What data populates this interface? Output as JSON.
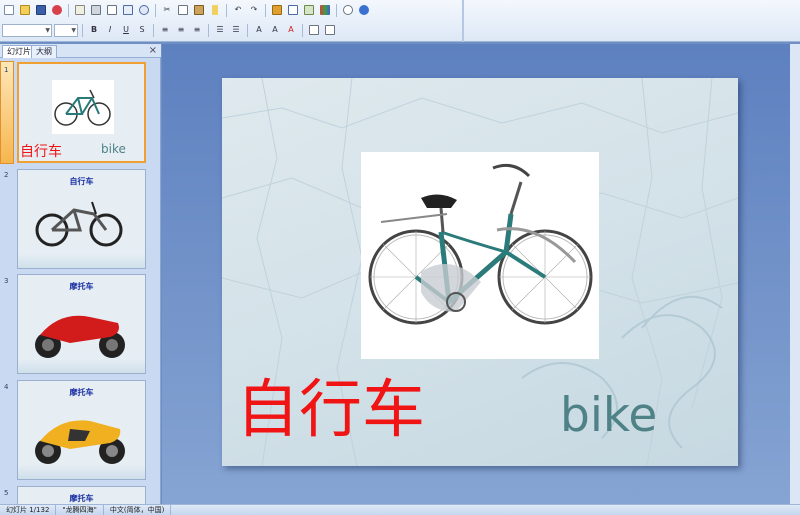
{
  "colors": {
    "accent": "#f0a030",
    "slide_title_cn": "#f01414",
    "slide_title_en": "#4e8286",
    "thumb_title": "#1a2fa0"
  },
  "toolbar": {
    "row1_icons": [
      "new-icon",
      "open-icon",
      "save-icon",
      "permission-icon",
      "email-icon",
      "print-icon",
      "print-preview-icon",
      "spelling-icon",
      "research-icon",
      "cut-icon",
      "copy-icon",
      "paste-icon",
      "format-painter-icon",
      "undo-icon",
      "redo-icon",
      "insert-chart-icon",
      "insert-table-icon",
      "insert-picture-icon",
      "color-grayscale-icon",
      "zoom-icon",
      "help-icon"
    ],
    "row2_icons": [
      "bold-icon",
      "italic-icon",
      "underline-icon",
      "shadow-icon",
      "align-left-icon",
      "center-icon",
      "align-right-icon",
      "numbering-icon",
      "bullets-icon",
      "increase-font-icon",
      "decrease-font-icon",
      "font-color-icon",
      "design-icon",
      "new-slide-icon"
    ]
  },
  "slides_pane": {
    "tabs": [
      {
        "label": "幻灯片"
      },
      {
        "label": "大纲"
      }
    ],
    "close_glyph": "×",
    "thumbnails": [
      {
        "number": "1",
        "title": "自行车",
        "subtitle": "bike",
        "image": "bike-icon"
      },
      {
        "number": "2",
        "title": "自行车",
        "image": "mountain-bike-icon"
      },
      {
        "number": "3",
        "title": "摩托车",
        "image": "motorcycle-red-icon"
      },
      {
        "number": "4",
        "title": "摩托车",
        "image": "motorcycle-yellow-icon"
      },
      {
        "number": "5",
        "title": "摩托车"
      }
    ]
  },
  "slide": {
    "title_cn": "自行车",
    "title_en": "bike",
    "image": "bike-icon"
  },
  "status_bar": {
    "slide_count": "幻灯片 1/132",
    "theme": "\"龙腾四海\"",
    "language": "中文(简体，中国)"
  }
}
